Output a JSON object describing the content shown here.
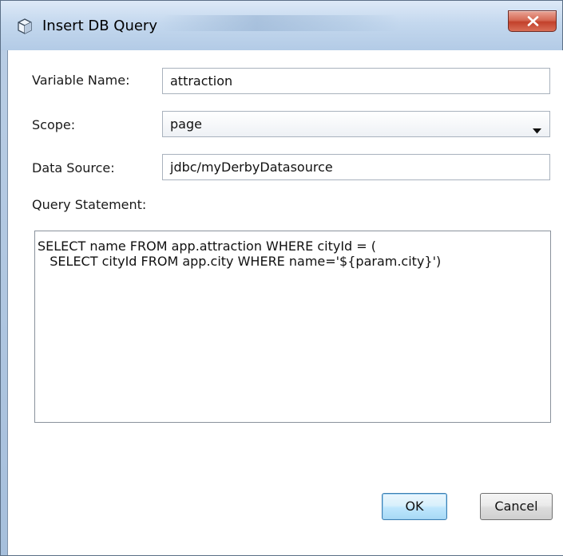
{
  "window": {
    "title": "Insert DB Query",
    "close_label": "X"
  },
  "form": {
    "variable_name_label": "Variable Name:",
    "variable_name_value": "attraction",
    "scope_label": "Scope:",
    "scope_value": "page",
    "data_source_label": "Data Source:",
    "data_source_value": "jdbc/myDerbyDatasource",
    "query_label": "Query Statement:",
    "query_value": "SELECT name FROM app.attraction WHERE cityId = (\n   SELECT cityId FROM app.city WHERE name='${param.city}')"
  },
  "buttons": {
    "ok_label": "OK",
    "cancel_label": "Cancel"
  },
  "icons": {
    "title_icon": "cube-icon",
    "close_icon": "close-icon",
    "dropdown_icon": "chevron-down-icon"
  },
  "colors": {
    "close_button": "#c2412b",
    "default_button_border": "#3c7fb1",
    "title_bar": "#c4d8ee"
  }
}
